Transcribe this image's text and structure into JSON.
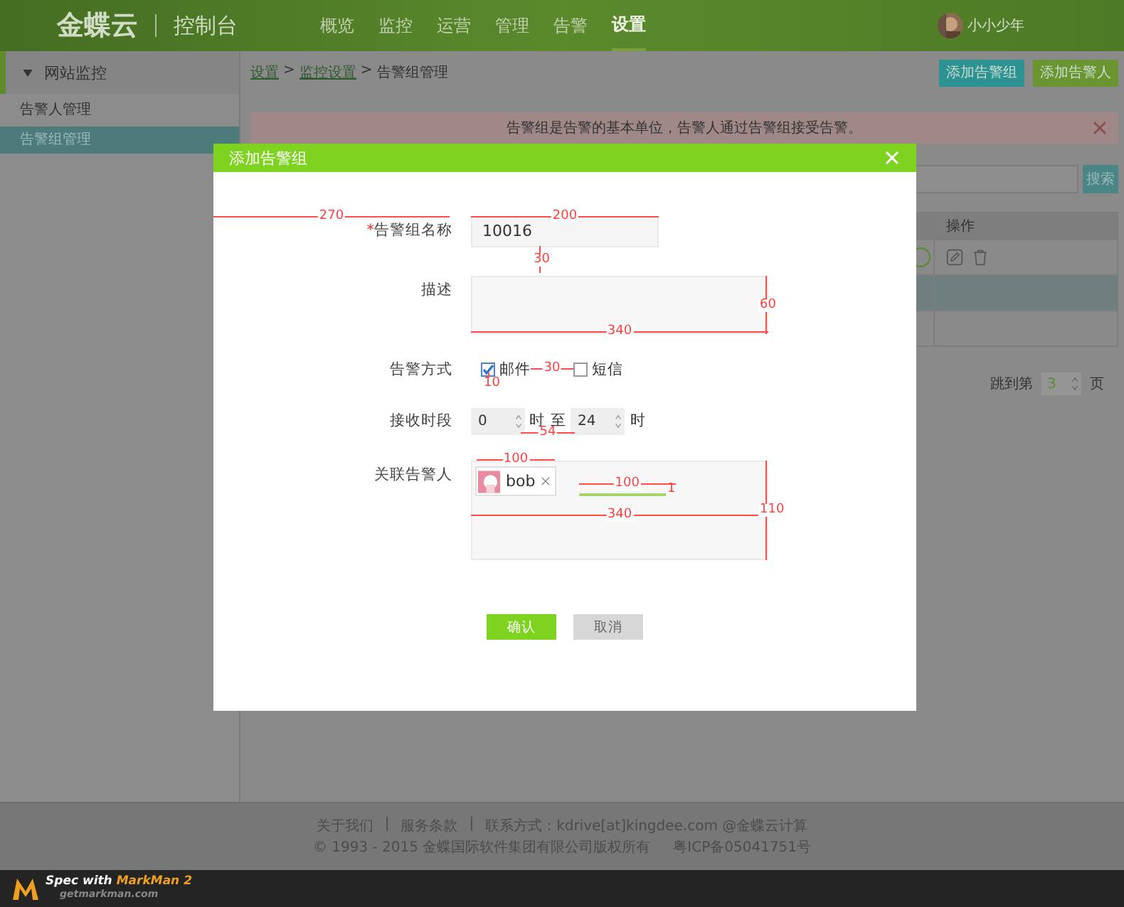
{
  "header": {
    "logo": "金蝶云",
    "console": "控制台",
    "nav": [
      {
        "label": "概览",
        "selected": false
      },
      {
        "label": "监控",
        "selected": false
      },
      {
        "label": "运营",
        "selected": false
      },
      {
        "label": "管理",
        "selected": false
      },
      {
        "label": "告警",
        "selected": false
      },
      {
        "label": "设置",
        "selected": true
      }
    ],
    "user": "小小少年"
  },
  "sidebar": {
    "section": "网站监控",
    "items": [
      {
        "label": "告警人管理",
        "selected": false
      },
      {
        "label": "告警组管理",
        "selected": true
      }
    ]
  },
  "breadcrumb": {
    "separator": ">",
    "items": [
      {
        "label": "设置",
        "link": true
      },
      {
        "label": "监控设置",
        "link": true
      },
      {
        "label": "告警组管理",
        "link": false
      }
    ]
  },
  "actions": [
    {
      "label": "添加告警组",
      "color": "#2c9292"
    },
    {
      "label": "添加告警人",
      "color": "#6a9530"
    }
  ],
  "notice": {
    "text": "告警组是告警的基本单位，告警人通过告警组接受告警。"
  },
  "search": {
    "button": "搜索"
  },
  "table": {
    "columns": [
      "操作"
    ],
    "rows": [
      {
        "kind": "actions",
        "selected": false
      },
      {
        "kind": "empty",
        "selected": true
      },
      {
        "kind": "empty",
        "selected": false
      }
    ]
  },
  "pagination": {
    "label": "跳到第",
    "page": "3",
    "unit": "页"
  },
  "footer": {
    "separator": "|",
    "links": [
      "关于我们",
      "服务条款"
    ],
    "contact": "联系方式：kdrive[at]kingdee.com @金蝶云计算",
    "copyright": "© 1993 - 2015 金蝶国际软件集团有限公司版权所有",
    "icp": "粤ICP备05041751号"
  },
  "markman": {
    "prefix": "Spec with",
    "name": "MarkMan 2",
    "site": "getmarkman.com"
  },
  "dialog": {
    "title": "添加告警组",
    "fields": [
      {
        "kind": "text",
        "label": "告警组名称",
        "required_mark": "*",
        "value": "10016",
        "measures": [
          {
            "kind": "label",
            "value": "270"
          },
          {
            "kind": "top",
            "value": "200"
          },
          {
            "kind": "below",
            "value": "30"
          }
        ]
      },
      {
        "kind": "textarea",
        "label": "描述",
        "measures": [
          {
            "kind": "right",
            "value": "60"
          },
          {
            "kind": "bottom",
            "value": "340"
          }
        ]
      },
      {
        "kind": "checks",
        "label": "告警方式",
        "options": [
          {
            "label": "邮件",
            "checked": true
          },
          {
            "label": "短信",
            "checked": false
          }
        ],
        "measures": [
          {
            "kind": "under",
            "value": "10"
          },
          {
            "kind": "gap",
            "value": "30"
          }
        ]
      },
      {
        "kind": "range",
        "label": "接收时段",
        "from": "0",
        "unit_from": "时",
        "between": "至",
        "to": "24",
        "unit_to": "时",
        "measures": [
          {
            "kind": "between",
            "value": "54"
          }
        ]
      },
      {
        "kind": "tags",
        "label": "关联告警人",
        "tags": [
          "bob"
        ],
        "measures": [
          {
            "kind": "tag",
            "value": "100"
          },
          {
            "kind": "caret",
            "value": "100"
          },
          {
            "kind": "caret-height",
            "value": "1"
          },
          {
            "kind": "right",
            "value": "110"
          },
          {
            "kind": "middle",
            "value": "340"
          }
        ]
      }
    ],
    "buttons": [
      {
        "label": "确认",
        "kind": "primary"
      },
      {
        "label": "取消",
        "kind": "secondary"
      }
    ]
  }
}
